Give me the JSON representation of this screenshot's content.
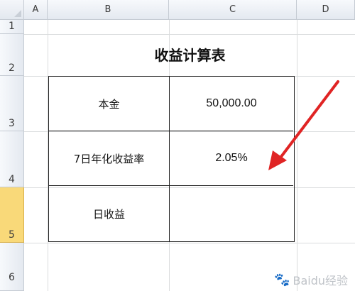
{
  "columns": [
    "A",
    "B",
    "C",
    "D"
  ],
  "rows": [
    "1",
    "2",
    "3",
    "4",
    "5",
    "6"
  ],
  "selected_row": "5",
  "title": "收益计算表",
  "table": [
    {
      "label": "本金",
      "value": "50,000.00"
    },
    {
      "label": "7日年化收益率",
      "value": "2.05%"
    },
    {
      "label": "日收益",
      "value": ""
    }
  ],
  "watermark": "Baidu经验",
  "colors": {
    "selected_row": "#f9d979",
    "arrow": "#e02424",
    "grid": "#dadcdd"
  }
}
